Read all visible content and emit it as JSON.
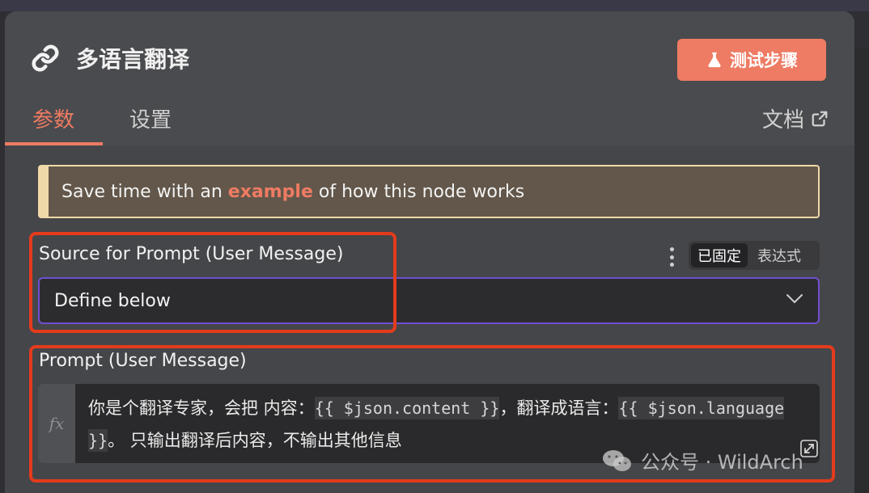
{
  "node": {
    "title": "多语言翻译",
    "test_button_label": "测试步骤"
  },
  "tabs": [
    {
      "label": "参数",
      "active": true
    },
    {
      "label": "设置",
      "active": false
    }
  ],
  "docs_label": "文档",
  "example_banner": {
    "prefix": "Save time with an",
    "link": "example",
    "suffix": "of how this node works"
  },
  "source_field": {
    "label": "Source for Prompt (User Message)",
    "toggle_fixed": "已固定",
    "toggle_expression": "表达式",
    "value": "Define below"
  },
  "prompt_field": {
    "label": "Prompt (User Message)",
    "fx_label": "fx",
    "text_part1": "你是个翻译专家，会把 内容：",
    "code1": "{{ $json.content }}",
    "text_part2": "，翻译成语言：",
    "code2": "{{ $json.language }}",
    "text_part3": "。 只输出翻译后内容，不输出其他信息"
  },
  "watermark": {
    "text": "公众号 · WildArch"
  },
  "colors": {
    "accent": "#ee7b63",
    "focus_border": "#6f4fd0",
    "annotation_red": "#e43b1c"
  }
}
